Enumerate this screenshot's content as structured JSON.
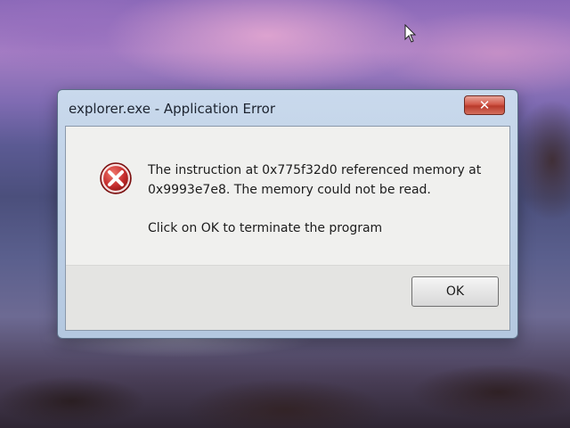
{
  "dialog": {
    "title": "explorer.exe - Application Error",
    "close_icon": "close-icon",
    "error_icon": "error-icon",
    "message_line1": "The instruction at 0x775f32d0 referenced memory at",
    "message_line2": "0x9993e7e8. The memory could not be read.",
    "instruction": "Click on OK to terminate the program",
    "ok_label": "OK"
  },
  "colors": {
    "close_button": "#c8473a",
    "error_icon": "#c62e2e",
    "dialog_frame": "#b9cbe2"
  }
}
